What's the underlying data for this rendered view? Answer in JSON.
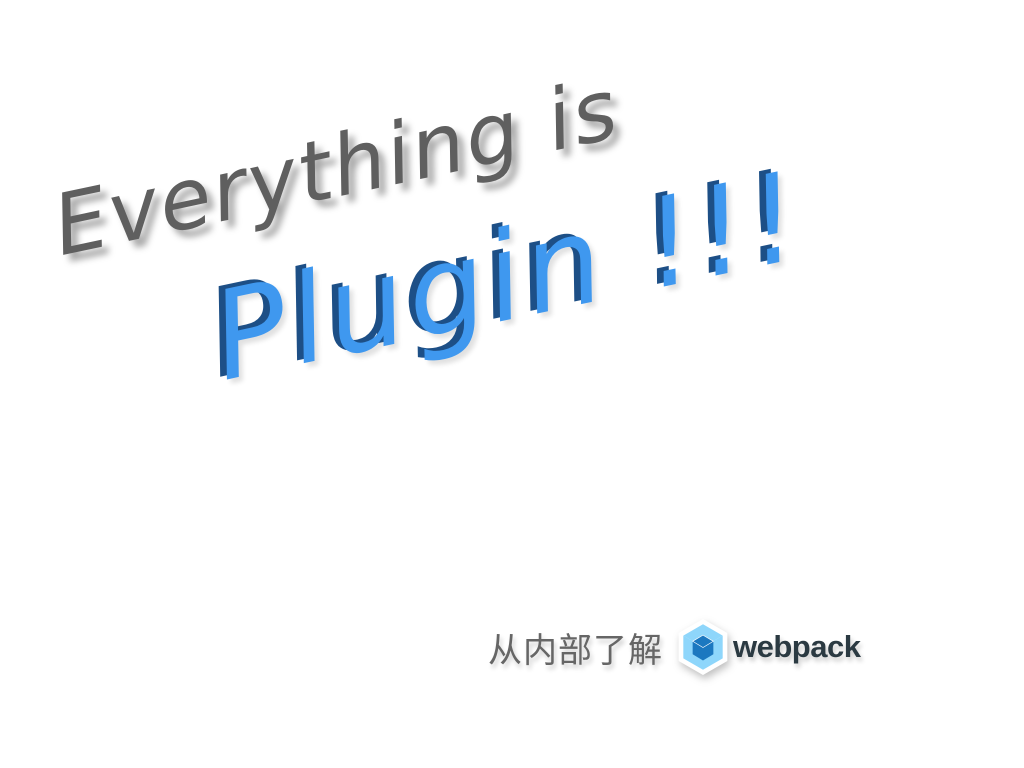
{
  "slide": {
    "headline": "Everything is",
    "emphasis": "Plugin !!!",
    "subtitle": "从内部了解",
    "logo": {
      "icon": "webpack-cube-icon",
      "wordmark": "webpack"
    }
  },
  "colors": {
    "headline": "#5f5f5f",
    "emphasis": "#3f98ef",
    "emphasis_shadow": "#1d4f86",
    "logo_outer": "#8ed6fb",
    "logo_inner": "#1c78c0",
    "wordmark": "#2b3a42"
  }
}
